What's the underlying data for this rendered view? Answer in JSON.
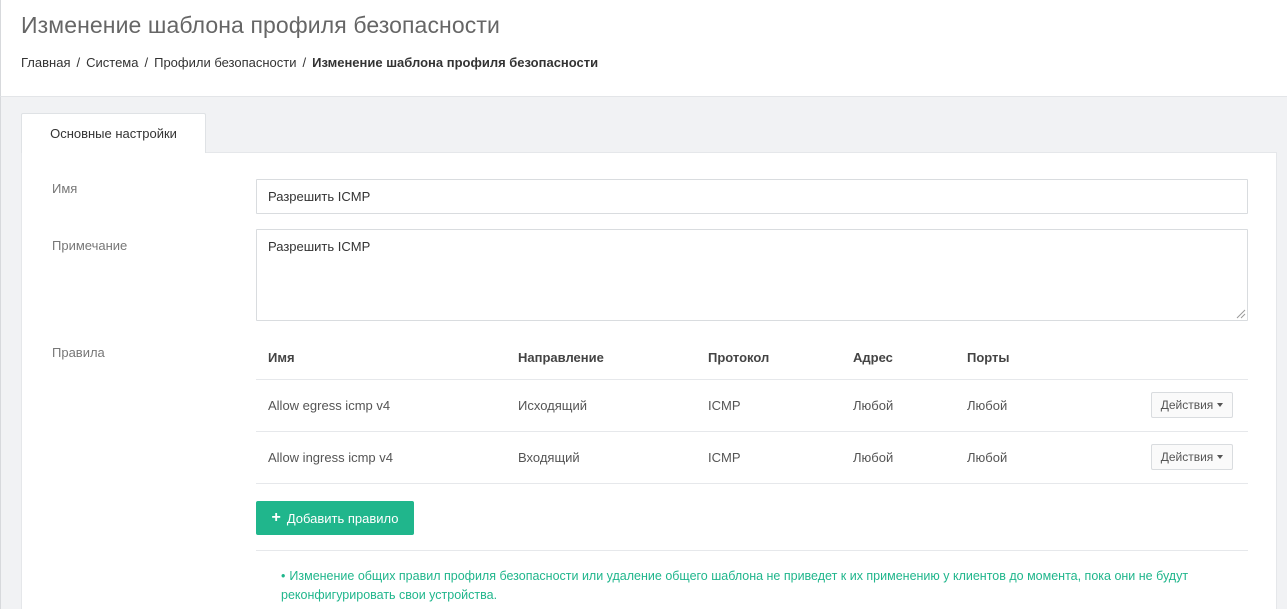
{
  "header": {
    "title": "Изменение шаблона профиля безопасности",
    "breadcrumb": {
      "items": [
        "Главная",
        "Система",
        "Профили безопасности"
      ],
      "separator": "/",
      "current": "Изменение шаблона профиля безопасности"
    }
  },
  "tabs": [
    {
      "label": "Основные настройки",
      "active": true
    }
  ],
  "form": {
    "name": {
      "label": "Имя",
      "value": "Разрешить ICMP"
    },
    "note": {
      "label": "Примечание",
      "value": "Разрешить ICMP"
    },
    "rules_label": "Правила"
  },
  "rules_table": {
    "columns": [
      "Имя",
      "Направление",
      "Протокол",
      "Адрес",
      "Порты"
    ],
    "rows": [
      {
        "name": "Allow egress icmp v4",
        "direction": "Исходящий",
        "protocol": "ICMP",
        "address": "Любой",
        "ports": "Любой",
        "actions_label": "Действия"
      },
      {
        "name": "Allow ingress icmp v4",
        "direction": "Входящий",
        "protocol": "ICMP",
        "address": "Любой",
        "ports": "Любой",
        "actions_label": "Действия"
      }
    ]
  },
  "add_rule_button": {
    "label": "Добавить правило",
    "icon": "plus-icon"
  },
  "notice": {
    "bullet": "•",
    "text": "Изменение общих правил профиля безопасности или удаление общего шаблона не приведет к их применению у клиентов до момента, пока они не будут реконфигурировать свои устройства."
  },
  "colors": {
    "accent": "#20b68c",
    "background": "#f1f2f4",
    "panel": "#ffffff",
    "border": "#e5e7ea",
    "text": "#555555"
  }
}
